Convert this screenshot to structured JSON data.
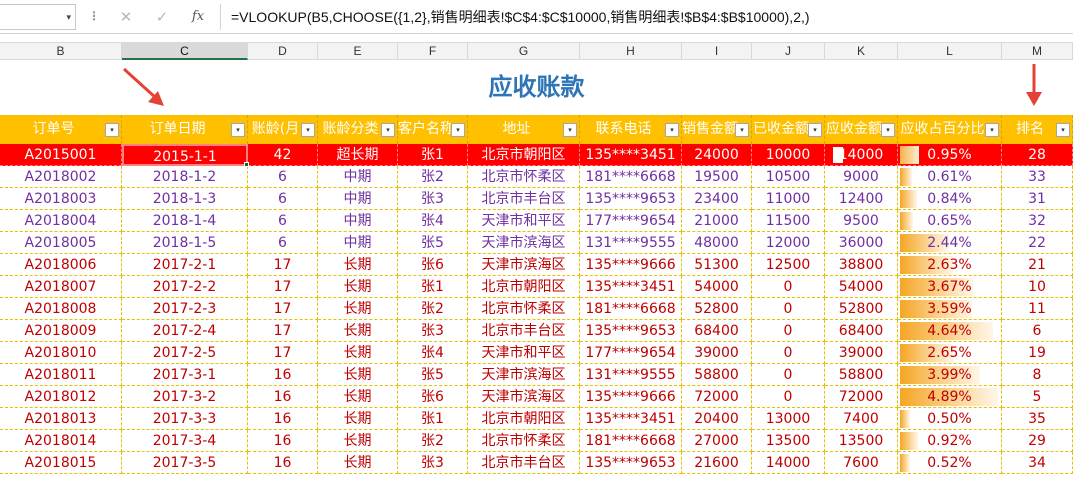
{
  "formula_bar": {
    "namebox_dropdown": "▾",
    "separator": "⋮",
    "cancel_glyph": "✕",
    "enter_glyph": "✓",
    "fx_label": "fx",
    "formula": "=VLOOKUP(B5,CHOOSE({1,2},销售明细表!$C$4:$C$10000,销售明细表!$B$4:$B$10000),2,)"
  },
  "columns": [
    "B",
    "C",
    "D",
    "E",
    "F",
    "G",
    "H",
    "I",
    "J",
    "K",
    "L",
    "M"
  ],
  "active_column": "C",
  "title": "应收账款",
  "header_labels": [
    "订单号",
    "订单日期",
    "账龄(月",
    "账龄分类",
    "客户名称",
    "地址",
    "联系电话",
    "销售金额",
    "已收金额",
    "应收金额",
    "应收占百分比",
    "排名"
  ],
  "filter_glyph": "▾",
  "colors": {
    "header_bg": "#ffc000",
    "title": "#2e75b6",
    "highlight_row": "#ff0000",
    "long_term": "#c00000",
    "mid_term": "#7030a0",
    "arrow": "#e34234"
  },
  "rows": [
    {
      "id": "A2015001",
      "date": "2015-1-1",
      "age": "42",
      "category": "超长期",
      "customer": "张1",
      "address": "北京市朝阳区",
      "phone": "135****3451",
      "sales": "24000",
      "received": "10000",
      "receivable": "14000",
      "pct": "0.95%",
      "pct_value": 0.95,
      "rank": "28",
      "type": "highlight"
    },
    {
      "id": "A2018002",
      "date": "2018-1-2",
      "age": "6",
      "category": "中期",
      "customer": "张2",
      "address": "北京市怀柔区",
      "phone": "181****6668",
      "sales": "19500",
      "received": "10500",
      "receivable": "9000",
      "pct": "0.61%",
      "pct_value": 0.61,
      "rank": "33",
      "type": "mid"
    },
    {
      "id": "A2018003",
      "date": "2018-1-3",
      "age": "6",
      "category": "中期",
      "customer": "张3",
      "address": "北京市丰台区",
      "phone": "135****9653",
      "sales": "23400",
      "received": "11000",
      "receivable": "12400",
      "pct": "0.84%",
      "pct_value": 0.84,
      "rank": "31",
      "type": "mid"
    },
    {
      "id": "A2018004",
      "date": "2018-1-4",
      "age": "6",
      "category": "中期",
      "customer": "张4",
      "address": "天津市和平区",
      "phone": "177****9654",
      "sales": "21000",
      "received": "11500",
      "receivable": "9500",
      "pct": "0.65%",
      "pct_value": 0.65,
      "rank": "32",
      "type": "mid"
    },
    {
      "id": "A2018005",
      "date": "2018-1-5",
      "age": "6",
      "category": "中期",
      "customer": "张5",
      "address": "天津市滨海区",
      "phone": "131****9555",
      "sales": "48000",
      "received": "12000",
      "receivable": "36000",
      "pct": "2.44%",
      "pct_value": 2.44,
      "rank": "22",
      "type": "mid"
    },
    {
      "id": "A2018006",
      "date": "2017-2-1",
      "age": "17",
      "category": "长期",
      "customer": "张6",
      "address": "天津市滨海区",
      "phone": "135****9666",
      "sales": "51300",
      "received": "12500",
      "receivable": "38800",
      "pct": "2.63%",
      "pct_value": 2.63,
      "rank": "21",
      "type": "long"
    },
    {
      "id": "A2018007",
      "date": "2017-2-2",
      "age": "17",
      "category": "长期",
      "customer": "张1",
      "address": "北京市朝阳区",
      "phone": "135****3451",
      "sales": "54000",
      "received": "0",
      "receivable": "54000",
      "pct": "3.67%",
      "pct_value": 3.67,
      "rank": "10",
      "type": "long"
    },
    {
      "id": "A2018008",
      "date": "2017-2-3",
      "age": "17",
      "category": "长期",
      "customer": "张2",
      "address": "北京市怀柔区",
      "phone": "181****6668",
      "sales": "52800",
      "received": "0",
      "receivable": "52800",
      "pct": "3.59%",
      "pct_value": 3.59,
      "rank": "11",
      "type": "long"
    },
    {
      "id": "A2018009",
      "date": "2017-2-4",
      "age": "17",
      "category": "长期",
      "customer": "张3",
      "address": "北京市丰台区",
      "phone": "135****9653",
      "sales": "68400",
      "received": "0",
      "receivable": "68400",
      "pct": "4.64%",
      "pct_value": 4.64,
      "rank": "6",
      "type": "long"
    },
    {
      "id": "A2018010",
      "date": "2017-2-5",
      "age": "17",
      "category": "长期",
      "customer": "张4",
      "address": "天津市和平区",
      "phone": "177****9654",
      "sales": "39000",
      "received": "0",
      "receivable": "39000",
      "pct": "2.65%",
      "pct_value": 2.65,
      "rank": "19",
      "type": "long"
    },
    {
      "id": "A2018011",
      "date": "2017-3-1",
      "age": "16",
      "category": "长期",
      "customer": "张5",
      "address": "天津市滨海区",
      "phone": "131****9555",
      "sales": "58800",
      "received": "0",
      "receivable": "58800",
      "pct": "3.99%",
      "pct_value": 3.99,
      "rank": "8",
      "type": "long"
    },
    {
      "id": "A2018012",
      "date": "2017-3-2",
      "age": "16",
      "category": "长期",
      "customer": "张6",
      "address": "天津市滨海区",
      "phone": "135****9666",
      "sales": "72000",
      "received": "0",
      "receivable": "72000",
      "pct": "4.89%",
      "pct_value": 4.89,
      "rank": "5",
      "type": "long"
    },
    {
      "id": "A2018013",
      "date": "2017-3-3",
      "age": "16",
      "category": "长期",
      "customer": "张1",
      "address": "北京市朝阳区",
      "phone": "135****3451",
      "sales": "20400",
      "received": "13000",
      "receivable": "7400",
      "pct": "0.50%",
      "pct_value": 0.5,
      "rank": "35",
      "type": "long"
    },
    {
      "id": "A2018014",
      "date": "2017-3-4",
      "age": "16",
      "category": "长期",
      "customer": "张2",
      "address": "北京市怀柔区",
      "phone": "181****6668",
      "sales": "27000",
      "received": "13500",
      "receivable": "13500",
      "pct": "0.92%",
      "pct_value": 0.92,
      "rank": "29",
      "type": "long"
    },
    {
      "id": "A2018015",
      "date": "2017-3-5",
      "age": "16",
      "category": "长期",
      "customer": "张3",
      "address": "北京市丰台区",
      "phone": "135****9653",
      "sales": "21600",
      "received": "14000",
      "receivable": "7600",
      "pct": "0.52%",
      "pct_value": 0.52,
      "rank": "34",
      "type": "long"
    }
  ]
}
